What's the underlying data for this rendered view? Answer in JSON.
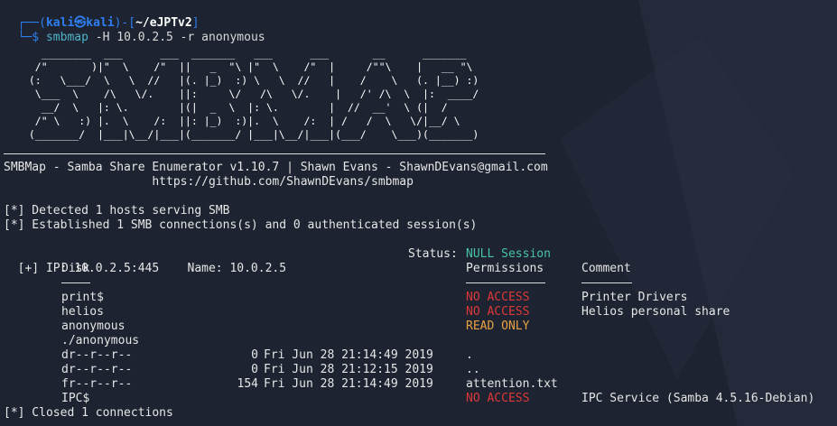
{
  "prompt": {
    "open": "┌──(",
    "user": "kali",
    "at": "㉿",
    "host": "kali",
    "close": ")-[",
    "path": "~/eJPTv2",
    "end": "]",
    "arrow": "└─$",
    "cmd_name": "smbmap",
    "cmd_args": " -H 10.0.2.5 -r anonymous"
  },
  "banner_art": "    ________  ___      ___  _______   ___      ___       __      _______\n   /\"       )|\"  \\    /\"  ||   _  \"\\ |\"  \\    /\"  |     /\"\"\\    |   __ \"\\\n  (:   \\___/  \\   \\  //   |(. |_)  :) \\   \\  //   |    /    \\   (. |__) :)\n   \\___  \\    /\\   \\/.    ||:     \\/   /\\   \\/.    |   /' /\\  \\  |:  ____/\n    __/  \\   |: \\.        |(|  _  \\  |: \\.        |  //  __'  \\ (|  /\n   /\" \\   :) |.  \\    /:  ||: |_)  :)|.  \\    /:  | /   /  \\   \\/|__/ \\\n  (_______/  |___|\\__/|___|(_______/ |___|\\__/|___|(___/    \\___)(_______)",
  "info": {
    "line1": "SMBMap - Samba Share Enumerator v1.10.7 | Shawn Evans - ShawnDEvans@gmail.com",
    "line2": "                     https://github.com/ShawnDEvans/smbmap"
  },
  "status_lines": [
    "[*] Detected 1 hosts serving SMB",
    "[*] Established 1 SMB connections(s) and 0 authenticated session(s)"
  ],
  "host": {
    "prefix": "[+] IP: 10.0.2.5:445    Name: 10.0.2.5",
    "status_label": "Status: ",
    "status_value": "NULL Session"
  },
  "headers": {
    "disk": "Disk",
    "permissions": "Permissions",
    "comment": "Comment"
  },
  "shares": [
    {
      "name": "print$",
      "perm": "NO ACCESS",
      "comment": "Printer Drivers"
    },
    {
      "name": "helios",
      "perm": "NO ACCESS",
      "comment": "Helios personal share"
    },
    {
      "name": "anonymous",
      "perm": "READ ONLY",
      "comment": ""
    }
  ],
  "listing": {
    "dir": "./anonymous",
    "entries": [
      {
        "mode": "dr--r--r--",
        "size": "0",
        "date": "Fri Jun 28 21:14:49 2019",
        "name": "."
      },
      {
        "mode": "dr--r--r--",
        "size": "0",
        "date": "Fri Jun 28 21:12:15 2019",
        "name": ".."
      },
      {
        "mode": "fr--r--r--",
        "size": "154",
        "date": "Fri Jun 28 21:14:49 2019",
        "name": "attention.txt"
      }
    ]
  },
  "ipc": {
    "name": "IPC$",
    "perm": "NO ACCESS",
    "comment": "IPC Service (Samba 4.5.16-Debian)"
  },
  "closed": "[*] Closed 1 connections",
  "colors": {
    "background": "#1d2331",
    "accent_blue": "#2f7ff2",
    "null_session": "#47c3a5",
    "no_access": "#dd3838",
    "read_only": "#e8a245"
  }
}
